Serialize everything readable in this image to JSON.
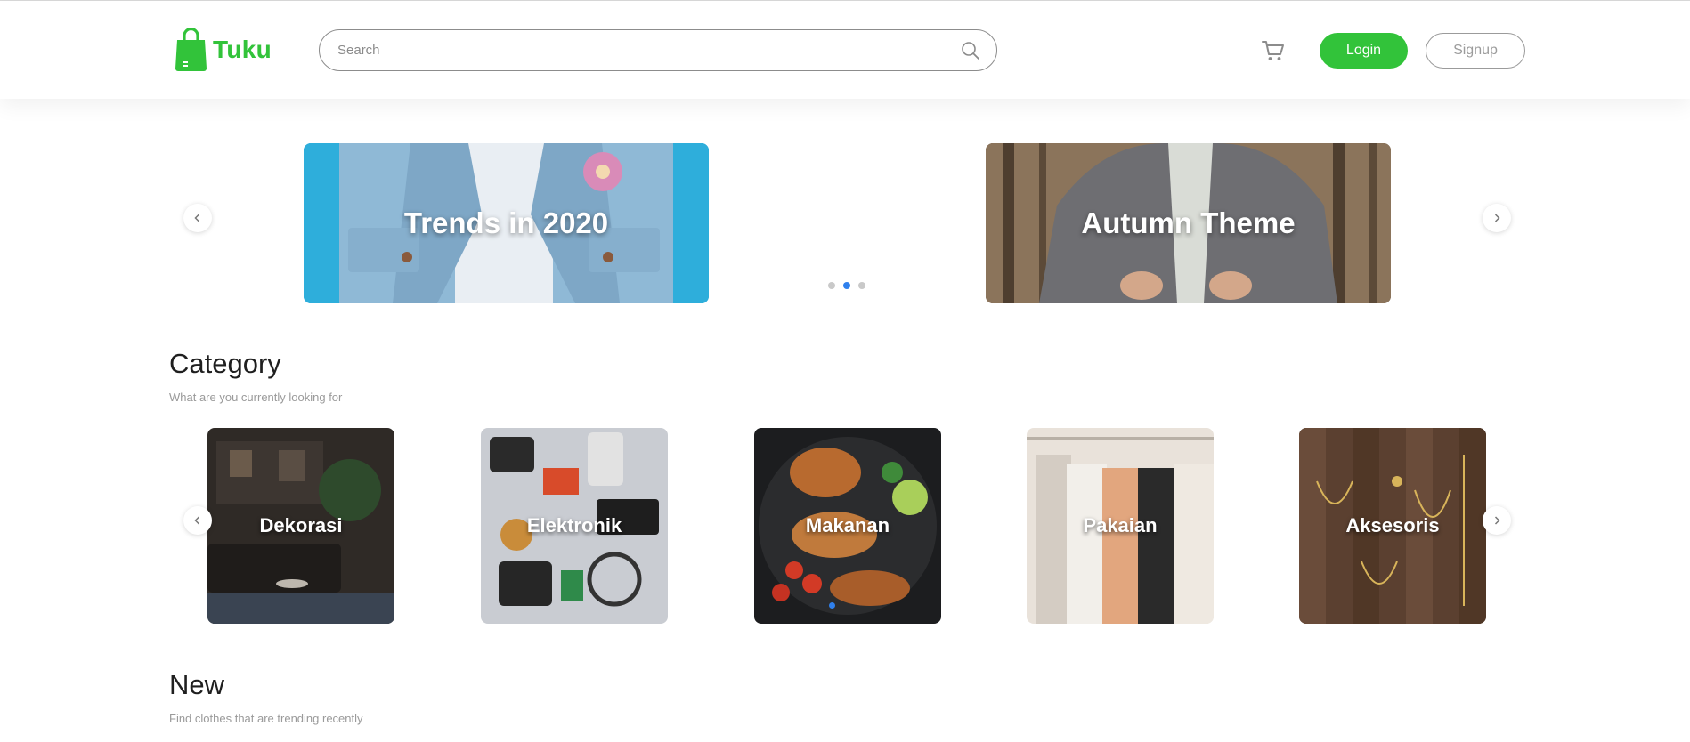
{
  "brand": {
    "name": "Tuku",
    "color": "#32c33a"
  },
  "search": {
    "placeholder": "Search",
    "value": ""
  },
  "header": {
    "login_label": "Login",
    "signup_label": "Signup",
    "cart_icon": "cart-icon"
  },
  "banners": [
    {
      "title": "Trends in 2020"
    },
    {
      "title": "Autumn Theme"
    }
  ],
  "banner_dots": {
    "count": 3,
    "active_index": 1
  },
  "category_section": {
    "title": "Category",
    "subtitle": "What are you currently looking for",
    "items": [
      {
        "label": "Dekorasi"
      },
      {
        "label": "Elektronik"
      },
      {
        "label": "Makanan"
      },
      {
        "label": "Pakaian"
      },
      {
        "label": "Aksesoris"
      }
    ],
    "active_dot_index": 0
  },
  "new_section": {
    "title": "New",
    "subtitle": "Find clothes that are trending recently"
  },
  "colors": {
    "accent": "#32c33a",
    "dot_active": "#2f80ed",
    "dot_inactive": "#c9c9c9"
  }
}
